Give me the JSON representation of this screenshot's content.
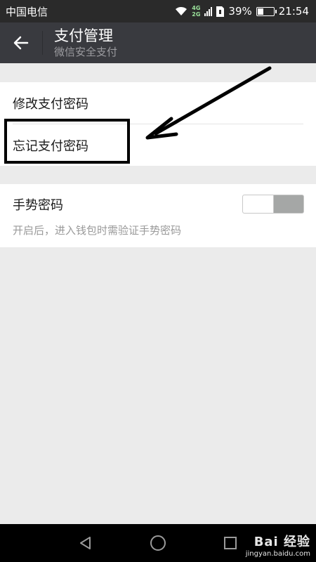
{
  "status_bar": {
    "carrier": "中国电信",
    "net_top": "4G",
    "net_bottom": "2G",
    "battery_percent": "39%",
    "battery_level": 0.39,
    "time": "21:54"
  },
  "header": {
    "back_icon": "arrow-left-icon",
    "title": "支付管理",
    "subtitle": "微信安全支付"
  },
  "password_group": {
    "items": [
      {
        "label": "修改支付密码"
      },
      {
        "label": "忘记支付密码"
      }
    ]
  },
  "gesture": {
    "label": "手势密码",
    "description": "开启后，进入钱包时需验证手势密码",
    "toggle_on": false
  },
  "nav_bar": {
    "back_icon": "triangle-back-icon",
    "home_icon": "circle-home-icon",
    "recents_icon": "square-recents-icon"
  },
  "watermark": {
    "main": "Bai 经验",
    "sub": "jingyan.baidu.com"
  },
  "colors": {
    "title_bar": "#393a3f",
    "status_bar": "#2a2a2a",
    "background": "#ebebeb"
  }
}
